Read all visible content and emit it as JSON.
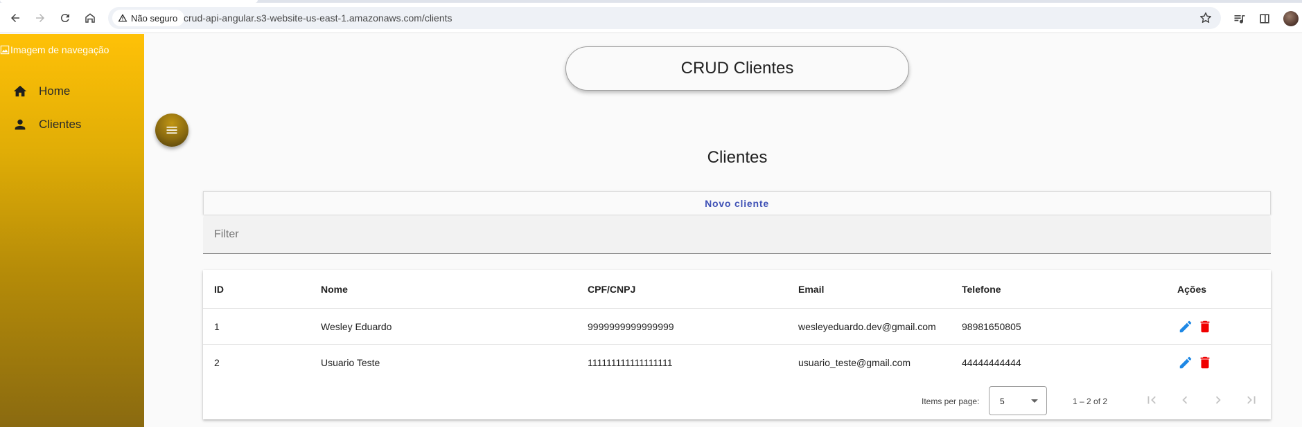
{
  "browser": {
    "security_label": "Não seguro",
    "url": "crud-api-angular.s3-website-us-east-1.amazonaws.com/clients"
  },
  "sidebar": {
    "image_alt": "Imagem de navegação",
    "items": [
      {
        "label": "Home",
        "icon": "home-icon"
      },
      {
        "label": "Clientes",
        "icon": "person-icon"
      }
    ]
  },
  "header": {
    "title": "CRUD Clientes"
  },
  "page": {
    "section_title": "Clientes",
    "new_button_label": "Novo cliente",
    "filter_placeholder": "Filter"
  },
  "table": {
    "columns": [
      "ID",
      "Nome",
      "CPF/CNPJ",
      "Email",
      "Telefone",
      "Ações"
    ],
    "rows": [
      {
        "id": "1",
        "nome": "Wesley Eduardo",
        "cpf": "9999999999999999",
        "email": "wesleyeduardo.dev@gmail.com",
        "telefone": "98981650805"
      },
      {
        "id": "2",
        "nome": "Usuario Teste",
        "cpf": "111111111111111111",
        "email": "usuario_teste@gmail.com",
        "telefone": "44444444444"
      }
    ]
  },
  "paginator": {
    "items_per_page_label": "Items per page:",
    "page_size": "5",
    "range_label": "1 – 2 of 2"
  },
  "colors": {
    "sidebar_top": "#ffc107",
    "sidebar_bottom": "#8a6a10",
    "accent": "#3f51b5",
    "edit_icon": "#1e88e5",
    "delete_icon": "#f00000"
  }
}
